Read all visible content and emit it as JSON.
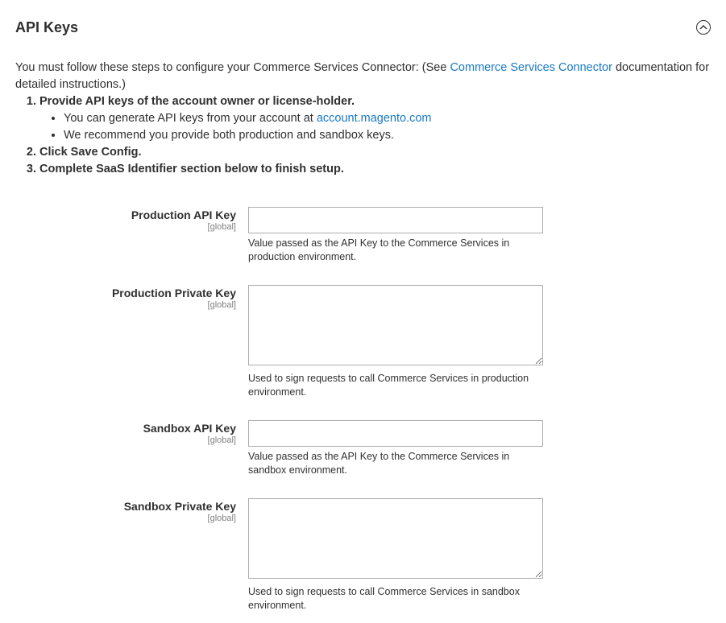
{
  "section": {
    "title": "API Keys"
  },
  "intro": {
    "text_before_link": "You must follow these steps to configure your Commerce Services Connector: (See ",
    "link_label": "Commerce Services Connector",
    "text_after_link": " documentation for detailed instructions.)",
    "steps": [
      {
        "label": "Provide API keys of the account owner or license-holder.",
        "substeps": [
          {
            "before": "You can generate API keys from your account at ",
            "link": "account.magento.com",
            "after": ""
          },
          {
            "before": "We recommend you provide both production and sandbox keys.",
            "link": "",
            "after": ""
          }
        ]
      },
      {
        "label": "Click Save Config."
      },
      {
        "label": "Complete SaaS Identifier section below to finish setup."
      }
    ]
  },
  "fields": {
    "production_api_key": {
      "label": "Production API Key",
      "scope": "[global]",
      "value": "",
      "note": "Value passed as the API Key to the Commerce Services in production environment."
    },
    "production_private_key": {
      "label": "Production Private Key",
      "scope": "[global]",
      "value": "",
      "note": "Used to sign requests to call Commerce Services in production environment."
    },
    "sandbox_api_key": {
      "label": "Sandbox API Key",
      "scope": "[global]",
      "value": "",
      "note": "Value passed as the API Key to the Commerce Services in sandbox environment."
    },
    "sandbox_private_key": {
      "label": "Sandbox Private Key",
      "scope": "[global]",
      "value": "",
      "note": "Used to sign requests to call Commerce Services in sandbox environment."
    }
  },
  "icons": {
    "collapse": "chevron-up-circle-icon"
  },
  "colors": {
    "link": "#1979c3",
    "text": "#303030",
    "scope": "#808080",
    "input_border": "#adadad"
  }
}
